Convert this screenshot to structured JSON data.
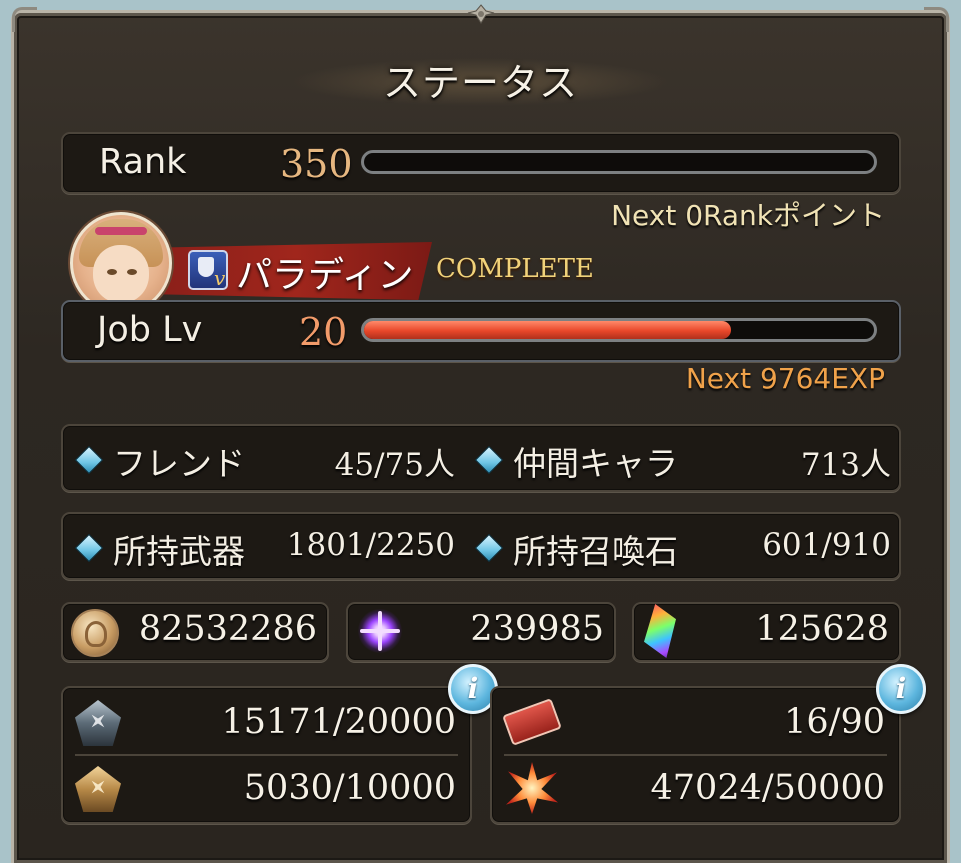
{
  "title": "ステータス",
  "rank": {
    "label": "Rank",
    "value": "350",
    "progress": 0.0,
    "next": "Next 0Rankポイント"
  },
  "job": {
    "name": "パラディン",
    "badge": "v",
    "status": "COMPLETE",
    "label": "Job Lv",
    "level": "20",
    "exp_progress": 0.72,
    "next": "Next 9764EXP"
  },
  "stats": [
    {
      "label": "フレンド",
      "value": "45/75人",
      "icon": "diamond-icon"
    },
    {
      "label": "仲間キャラ",
      "value": "713人",
      "icon": "diamond-icon"
    },
    {
      "label": "所持武器",
      "value": "1801/2250",
      "icon": "diamond-icon"
    },
    {
      "label": "所持召喚石",
      "value": "601/910",
      "icon": "diamond-icon"
    }
  ],
  "currencies": [
    {
      "icon": "rupie-coin-icon",
      "value": "82532286"
    },
    {
      "icon": "crystal-icon",
      "value": "239985"
    },
    {
      "icon": "gem-icon",
      "value": "125628"
    }
  ],
  "materials_left": [
    {
      "icon": "blue-pentagon-icon",
      "value": "15171/20000"
    },
    {
      "icon": "gold-pentagon-icon",
      "value": "5030/10000"
    }
  ],
  "materials_right": [
    {
      "icon": "ticket-icon",
      "value": "16/90"
    },
    {
      "icon": "burst-icon",
      "value": "47024/50000"
    }
  ],
  "info_glyph": "i",
  "colors": {
    "rank_number": "#e6b780",
    "exp_bar": "#e8472a",
    "next_exp": "#f0a24a",
    "next_rank": "#f1e3b5"
  }
}
